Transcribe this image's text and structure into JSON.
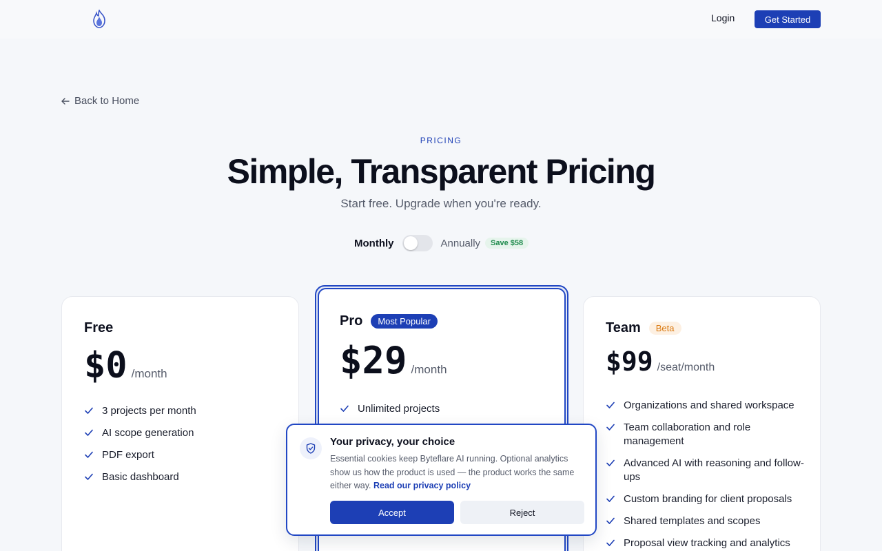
{
  "header": {
    "logo_icon": "flame-logo-icon",
    "login_label": "Login",
    "cta_label": "Get Started"
  },
  "back_link": {
    "label": "Back to Home",
    "icon": "arrow-left-icon"
  },
  "hero": {
    "eyebrow": "PRICING",
    "title": "Simple, Transparent Pricing",
    "subtitle": "Start free. Upgrade when you're ready."
  },
  "billing": {
    "monthly_label": "Monthly",
    "annual_label": "Annually",
    "save_badge": "Save $58",
    "annual_selected": false
  },
  "plans": [
    {
      "name": "Free",
      "price": "$0",
      "period": "/month",
      "badge": "",
      "features": [
        "3 projects per month",
        "AI scope generation",
        "PDF export",
        "Basic dashboard"
      ]
    },
    {
      "name": "Pro",
      "price": "$29",
      "period": "/month",
      "badge": "Most Popular",
      "features": [
        "Unlimited projects"
      ]
    },
    {
      "name": "Team",
      "price": "$99",
      "period": "/seat/month",
      "badge": "Beta",
      "features": [
        "Organizations and shared workspace",
        "Team collaboration and role management",
        "Advanced AI with reasoning and follow-ups",
        "Custom branding for client proposals",
        "Shared templates and scopes",
        "Proposal view tracking and analytics"
      ]
    }
  ],
  "cookie": {
    "icon": "shield-check-icon",
    "title": "Your privacy, your choice",
    "text": "Essential cookies keep Byteflare AI running. Optional analytics show us how the product is used — the product works the same either way.",
    "link_label": "Read our privacy policy",
    "accept_label": "Accept",
    "reject_label": "Reject"
  },
  "colors": {
    "primary": "#1d3fb5",
    "background": "#f5f7fa",
    "save_green": "#1e8a4c",
    "beta_orange": "#d9780f"
  }
}
